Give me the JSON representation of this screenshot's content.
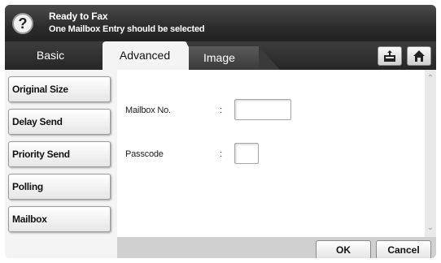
{
  "status": {
    "help_icon_glyph": "?",
    "title": "Ready to Fax",
    "message": "One Mailbox Entry should be selected"
  },
  "tabs": {
    "basic": "Basic",
    "advanced": "Advanced",
    "image": "Image",
    "active": "Advanced"
  },
  "toolbar_icons": [
    "job-status-icon",
    "home-icon"
  ],
  "sidebar": {
    "items": [
      {
        "label": "Original Size"
      },
      {
        "label": "Delay Send"
      },
      {
        "label": "Priority Send"
      },
      {
        "label": "Polling"
      },
      {
        "label": "Mailbox"
      }
    ]
  },
  "form": {
    "mailbox_label": "Mailbox No.",
    "mailbox_colon": ":",
    "mailbox_value": "",
    "passcode_label": "Passcode",
    "passcode_colon": ":",
    "passcode_value": ""
  },
  "actions": {
    "ok": "OK",
    "cancel": "Cancel"
  }
}
